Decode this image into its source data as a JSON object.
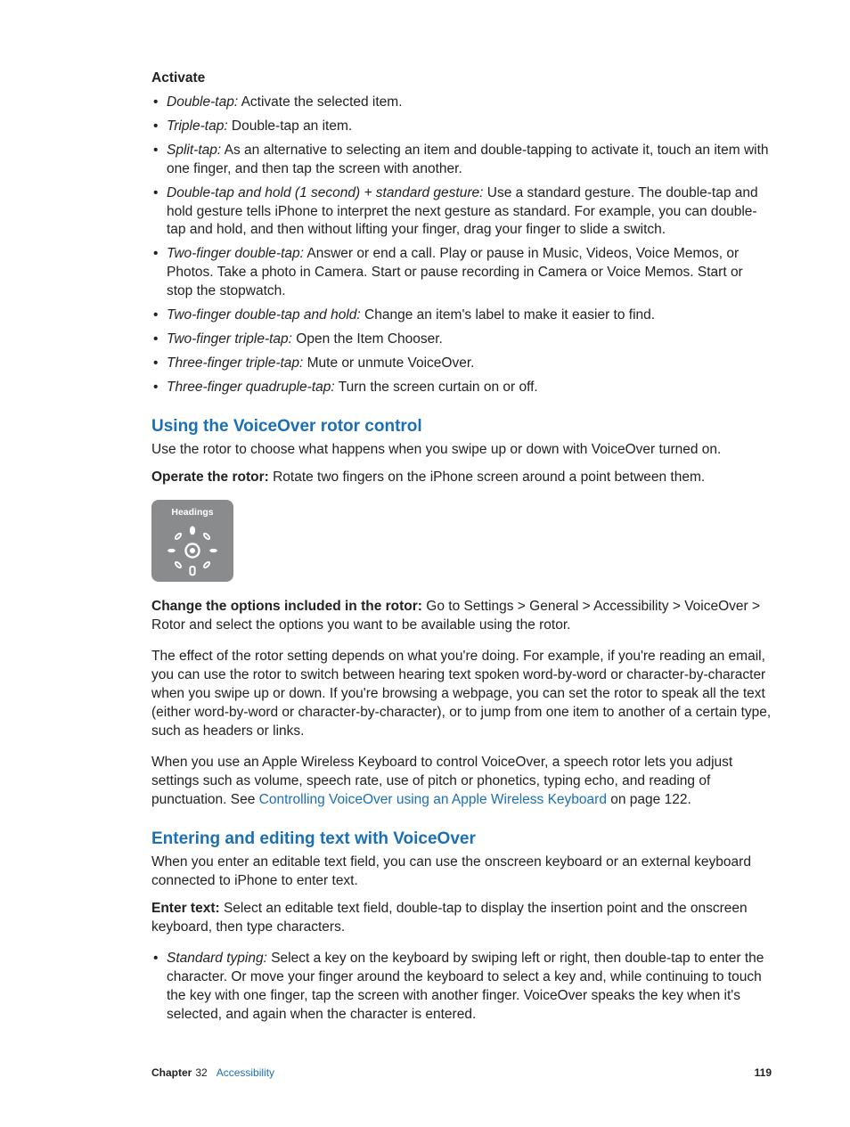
{
  "activate": {
    "heading": "Activate",
    "items": [
      {
        "term": "Double-tap:",
        "desc": "  Activate the selected item."
      },
      {
        "term": "Triple-tap:",
        "desc": "  Double-tap an item."
      },
      {
        "term": "Split-tap:",
        "desc": "  As an alternative to selecting an item and double-tapping to activate it, touch an item with one finger, and then tap the screen with another."
      },
      {
        "term": "Double-tap and hold (1 second) + standard gesture:",
        "desc": "  Use a standard gesture. The double-tap and hold gesture tells iPhone to interpret the next gesture as standard. For example, you can double-tap and hold, and then without lifting your finger, drag your finger to slide a switch."
      },
      {
        "term": "Two-finger double-tap:",
        "desc": "  Answer or end a call. Play or pause in Music, Videos, Voice Memos, or Photos. Take a photo in Camera. Start or pause recording in Camera or Voice Memos. Start or stop the stopwatch."
      },
      {
        "term": "Two-finger double-tap and hold:",
        "desc": "  Change an item's label to make it easier to find."
      },
      {
        "term": "Two-finger triple-tap:",
        "desc": "  Open the Item Chooser."
      },
      {
        "term": "Three-finger triple-tap:",
        "desc": "  Mute or unmute VoiceOver."
      },
      {
        "term": "Three-finger quadruple-tap:",
        "desc": "  Turn the screen curtain on or off."
      }
    ]
  },
  "rotor": {
    "heading": "Using the VoiceOver rotor control",
    "intro": "Use the rotor to choose what happens when you swipe up or down with VoiceOver turned on.",
    "operate_lead": "Operate the rotor:",
    "operate_desc": "  Rotate two fingers on the iPhone screen around a point between them.",
    "widget_label": "Headings",
    "change_lead": "Change the options included in the rotor:",
    "change_desc": "  Go to Settings > General > Accessibility > VoiceOver > Rotor and select the options you want to be available using the rotor.",
    "effect": "The effect of the rotor setting depends on what you're doing. For example, if you're reading an email, you can use the rotor to switch between hearing text spoken word-by-word or character-by-character when you swipe up or down. If you're browsing a webpage, you can set the rotor to speak all the text (either word-by-word or character-by-character), or to jump from one item to another of a certain type, such as headers or links.",
    "keyboard_pre": "When you use an Apple Wireless Keyboard to control VoiceOver, a speech rotor lets you adjust settings such as volume, speech rate, use of pitch or phonetics, typing echo, and reading of punctuation. See ",
    "keyboard_link": "Controlling VoiceOver using an Apple Wireless Keyboard",
    "keyboard_post": " on page 122."
  },
  "editing": {
    "heading": "Entering and editing text with VoiceOver",
    "intro": "When you enter an editable text field, you can use the onscreen keyboard or an external keyboard connected to iPhone to enter text.",
    "enter_lead": "Enter text:",
    "enter_desc": "  Select an editable text field, double-tap to display the insertion point and the onscreen keyboard, then type characters.",
    "items": [
      {
        "term": "Standard typing:",
        "desc": "  Select a key on the keyboard by swiping left or right, then double-tap to enter the character. Or move your finger around the keyboard to select a key and, while continuing to touch the key with one finger, tap the screen with another finger. VoiceOver speaks the key when it's selected, and again when the character is entered."
      }
    ]
  },
  "footer": {
    "chapter_label": "Chapter",
    "chapter_num": "32",
    "chapter_name": "Accessibility",
    "page": "119"
  }
}
